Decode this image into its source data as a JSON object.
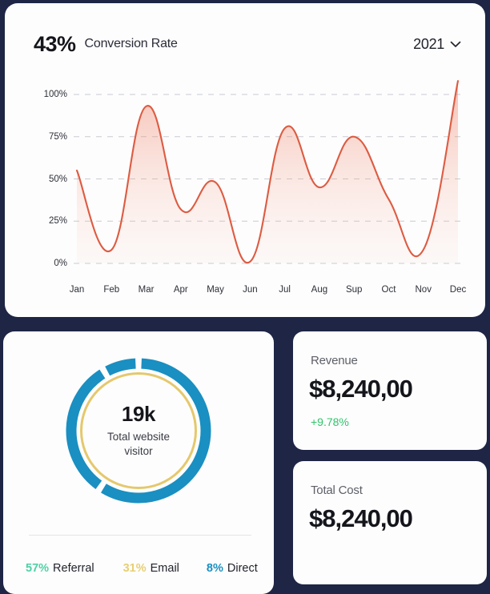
{
  "theme": {
    "page_background": "#1e2545",
    "card_background": "#fdfdfd",
    "line_color": "#dd5b42",
    "donut_blue": "#1a8fc1",
    "donut_gold": "#e5c86d",
    "positive_green": "#2fc46b",
    "referral_green": "#4fd1a5",
    "email_gold": "#e8cf72",
    "direct_blue": "#1a8fc1"
  },
  "conversion_card": {
    "percent": "43%",
    "title": "Conversion Rate",
    "year_filter": {
      "value": "2021",
      "icon": "chevron-down-icon"
    }
  },
  "donut_card": {
    "center_value": "19k",
    "center_caption": "Total website visitor",
    "legend": [
      {
        "percent": "57%",
        "label": "Referral",
        "color": "#4fd1a5"
      },
      {
        "percent": "31%",
        "label": "Email",
        "color": "#e8cf72"
      },
      {
        "percent": "8%",
        "label": "Direct",
        "color": "#1a8fc1"
      }
    ]
  },
  "stats": [
    {
      "label": "Revenue",
      "value": "$8,240,00",
      "delta": "+9.78%"
    },
    {
      "label": "Total Cost",
      "value": "$8,240,00",
      "delta": ""
    }
  ],
  "chart_data": {
    "type": "area",
    "title": "Conversion Rate",
    "xlabel": "",
    "ylabel": "",
    "grid": true,
    "legend_position": "none",
    "categories": [
      "Jan",
      "Feb",
      "Mar",
      "Apr",
      "May",
      "Jun",
      "Jul",
      "Aug",
      "Sup",
      "Oct",
      "Nov",
      "Dec"
    ],
    "tick_labels_y": [
      "0%",
      "25%",
      "50%",
      "75%",
      "100%"
    ],
    "ylim": [
      0,
      110
    ],
    "yticks": [
      0,
      25,
      50,
      75,
      100
    ],
    "series": [
      {
        "name": "Conversion Rate",
        "color": "#dd5b42",
        "values": [
          55,
          8,
          93,
          32,
          48,
          1,
          80,
          45,
          75,
          38,
          8,
          108
        ]
      }
    ]
  }
}
